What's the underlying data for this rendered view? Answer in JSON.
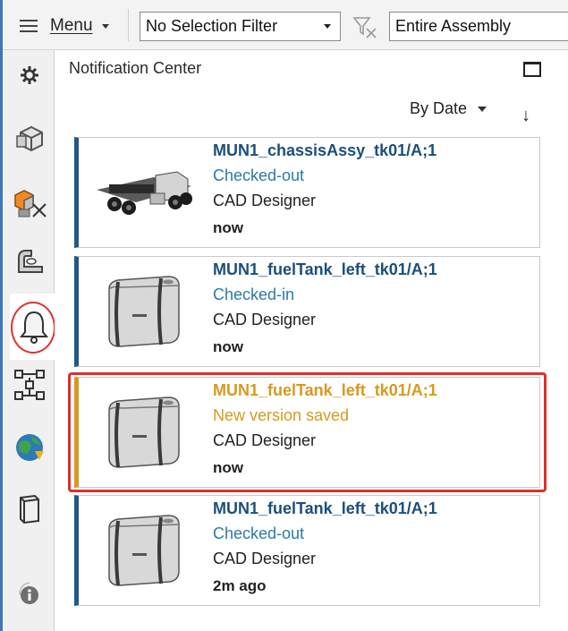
{
  "toolbar": {
    "menu_label": "Menu",
    "selection_filter": "No Selection Filter",
    "scope": "Entire Assembly"
  },
  "sidebar": {
    "icons": [
      "gear-icon",
      "part-icon",
      "assembly-icon",
      "sheet-metal-icon",
      "bell-icon",
      "structure-tree-icon",
      "globe-icon",
      "book-icon",
      "info-icon"
    ]
  },
  "panel": {
    "title": "Notification Center",
    "sort_label": "By Date",
    "sort_direction_icon": "↓"
  },
  "notifications": [
    {
      "title": "MUN1_chassisAssy_tk01/A;1",
      "status": "Checked-out",
      "user": "CAD Designer",
      "time": "now",
      "thumbnail": "chassis-thumbnail"
    },
    {
      "title": "MUN1_fuelTank_left_tk01/A;1",
      "status": "Checked-in",
      "user": "CAD Designer",
      "time": "now",
      "thumbnail": "fuel-tank-thumbnail"
    },
    {
      "title": "MUN1_fuelTank_left_tk01/A;1",
      "status": "New version saved",
      "user": "CAD Designer",
      "time": "now",
      "thumbnail": "fuel-tank-thumbnail",
      "highlighted": true
    },
    {
      "title": "MUN1_fuelTank_left_tk01/A;1",
      "status": "Checked-out",
      "user": "CAD Designer",
      "time": "2m ago",
      "thumbnail": "fuel-tank-thumbnail"
    }
  ],
  "colors": {
    "accent_blue": "#1f5a8a",
    "status_blue": "#2a7aa8",
    "highlight_gold": "#d69a1e",
    "annotation_red": "#e0302a"
  }
}
